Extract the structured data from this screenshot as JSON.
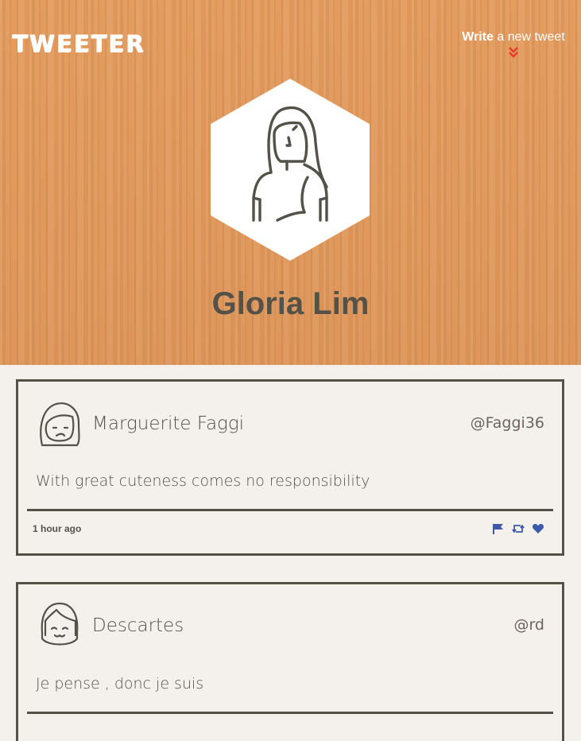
{
  "header": {
    "logo": "TWEETER",
    "write": {
      "bold": "Write",
      "rest": " a new tweet"
    },
    "icons": [
      "double-chevron-down-icon"
    ]
  },
  "profile": {
    "first_name": "Gloria",
    "last_name": "Lim",
    "avatar": "user-avatar-icon"
  },
  "tweets": [
    {
      "name": "Marguerite Faggi",
      "handle": "@Faggi36",
      "text": "With great cuteness comes no responsibility",
      "time": "1 hour ago",
      "actions": [
        "flag-icon",
        "retweet-icon",
        "heart-icon"
      ]
    },
    {
      "name": "Descartes",
      "handle": "@rd",
      "text": "Je pense , donc je suis"
    }
  ],
  "colors": {
    "header_wood": "#e0975a",
    "page_bg": "#f4f1ec",
    "text_dark": "#545149",
    "accent_red": "#e53b2c",
    "action_blue": "#3b5aa8"
  }
}
